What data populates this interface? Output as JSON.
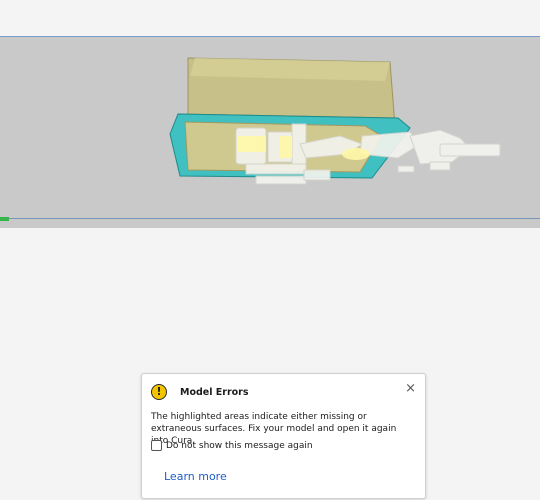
{
  "viewport": {
    "bg_color": "#c9c9c9",
    "model_color": "#c9c28a",
    "highlight_color": "#3fbfbf"
  },
  "dialog": {
    "icon": "warning-icon",
    "icon_glyph": "!",
    "title": "Model Errors",
    "close_glyph": "×",
    "message": "The highlighted areas indicate either missing or extraneous surfaces. Fix your model and open it again into Cura.",
    "checkbox_label": "Do not show this message again",
    "checkbox_checked": false,
    "link_label": "Learn more"
  }
}
